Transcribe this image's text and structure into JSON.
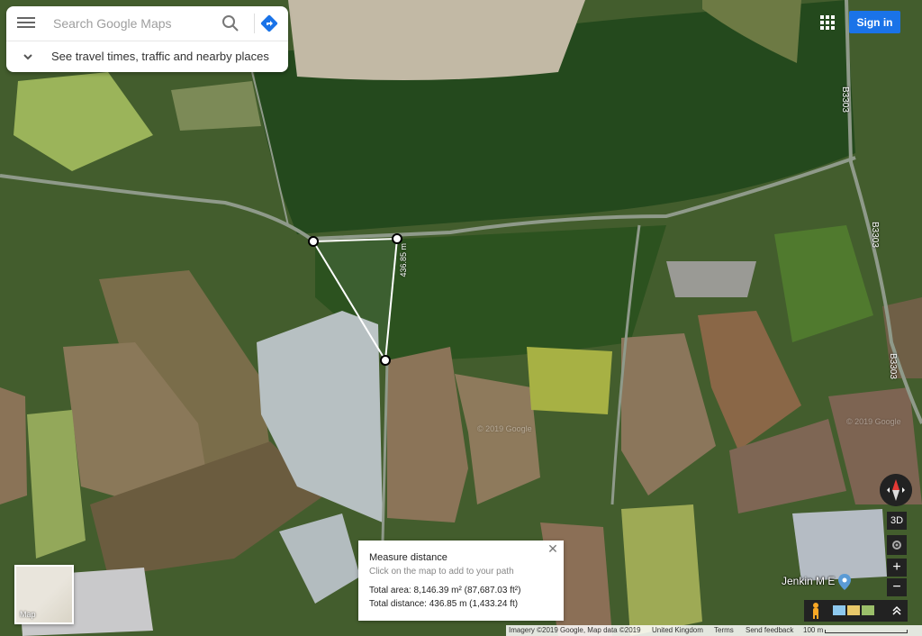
{
  "search": {
    "placeholder": "Search Google Maps",
    "travel_prompt": "See travel times, traffic and nearby places"
  },
  "header": {
    "signin_label": "Sign in"
  },
  "map": {
    "type": "satellite",
    "road_labels": [
      "B3303",
      "B3303",
      "B3303"
    ],
    "measure_segment_label": "436.85 m",
    "watermarks": [
      "© 2019 Google",
      "© 2019 Google"
    ],
    "place_label": "Jenkin M E"
  },
  "measure": {
    "title": "Measure distance",
    "hint": "Click on the map to add to your path",
    "area": "Total area: 8,146.39 m² (87,687.03 ft²)",
    "distance": "Total distance: 436.85 m (1,433.24 ft)",
    "close": "✕"
  },
  "minimap": {
    "label": "Map"
  },
  "controls": {
    "three_d": "3D",
    "zoom_in": "+",
    "zoom_out": "−"
  },
  "footer": {
    "imagery": "Imagery ©2019 Google, Map data ©2019",
    "region": "United Kingdom",
    "terms": "Terms",
    "feedback": "Send feedback",
    "scale": "100 m"
  },
  "colors": {
    "accent": "#1a73e8",
    "measure_line": "#ffffff"
  }
}
